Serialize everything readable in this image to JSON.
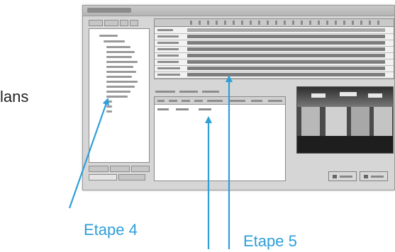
{
  "body_text_fragment": "lans",
  "annotations": {
    "step4": "Etape 4",
    "step5": "Etape 5"
  },
  "colors": {
    "annotation": "#2f9fd8"
  }
}
